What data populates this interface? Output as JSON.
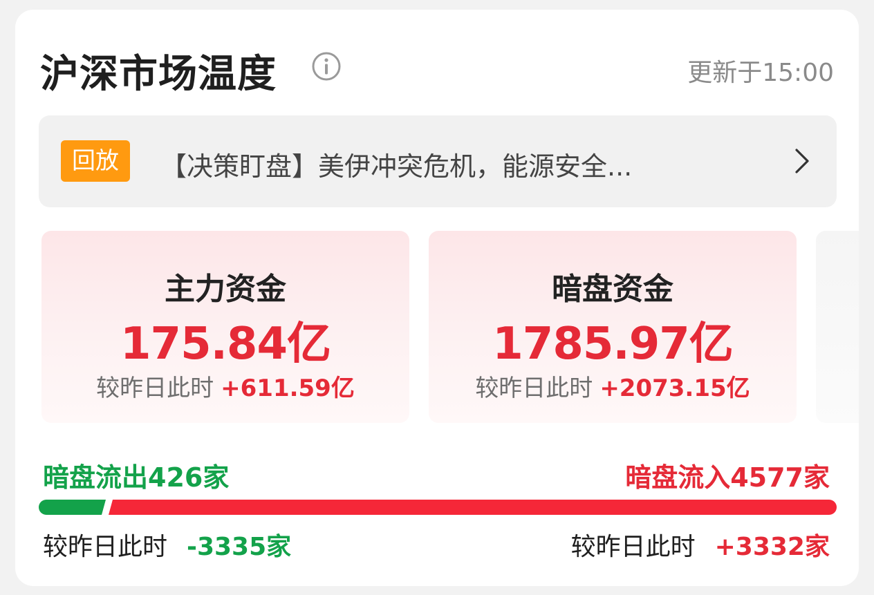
{
  "header": {
    "title": "沪深市场温度",
    "update_time": "更新于15:00"
  },
  "banner": {
    "badge": "回放",
    "text": "【决策盯盘】美伊冲突危机，能源安全..."
  },
  "stats": [
    {
      "label": "主力资金",
      "value": "175.84亿",
      "delta_label": "较昨日此时",
      "delta_value": "+611.59亿"
    },
    {
      "label": "暗盘资金",
      "value": "1785.97亿",
      "delta_label": "较昨日此时",
      "delta_value": "+2073.15亿"
    }
  ],
  "flow": {
    "outflow_label": "暗盘流出426家",
    "inflow_label": "暗盘流入4577家",
    "outflow_count": 426,
    "inflow_count": 4577,
    "out_delta_label": "较昨日此时",
    "out_delta_value": "-3335家",
    "in_delta_label": "较昨日此时",
    "in_delta_value": "+3332家"
  },
  "colors": {
    "rise": "#e52a37",
    "fall": "#13a24a",
    "badge": "#ff9a10"
  },
  "icons": {
    "info": "info-icon",
    "chevron": "chevron-right-icon"
  }
}
